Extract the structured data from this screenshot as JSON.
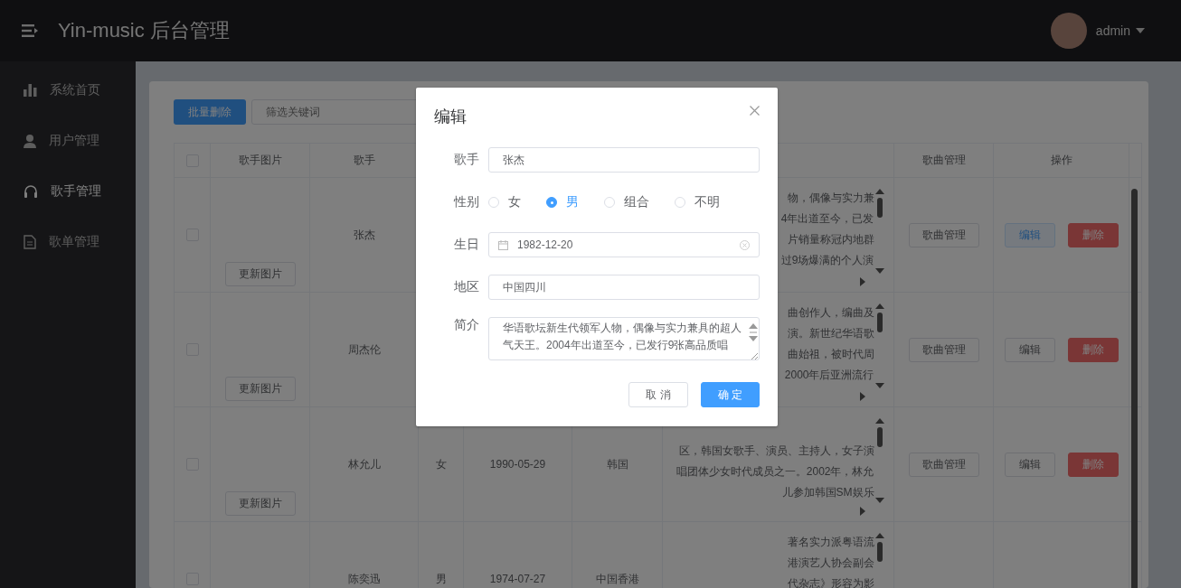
{
  "header": {
    "title": "Yin-music 后台管理",
    "user": "admin"
  },
  "sidebar": {
    "items": [
      {
        "kind": "chart",
        "label": "系统首页",
        "selected": false
      },
      {
        "kind": "user",
        "label": "用户管理",
        "selected": false
      },
      {
        "kind": "headset",
        "label": "歌手管理",
        "selected": true
      },
      {
        "kind": "doc",
        "label": "歌单管理",
        "selected": false
      }
    ]
  },
  "toolbar": {
    "batch_delete": "批量删除",
    "search": {
      "placeholder": "筛选关键词"
    }
  },
  "table": {
    "select_all": {
      "checked": false
    },
    "columns": [
      {
        "kind": "button",
        "label": "歌手图片"
      },
      {
        "kind": "text",
        "label": "歌手"
      },
      {
        "kind": "text"
      },
      {
        "kind": "text"
      },
      {
        "kind": "text"
      },
      {
        "kind": "intro"
      },
      {
        "kind": "button",
        "label": "歌曲管理"
      },
      {
        "kind": "actions",
        "label": "操作"
      }
    ],
    "rows": [
      {
        "checked": false,
        "cells": [
          "更新图片",
          "张杰",
          null,
          null,
          null,
          [
            "物，偶像与实力兼",
            "4年出道至今，已发",
            "片销量称冠内地群",
            "过9场爆满的个人演"
          ],
          "歌曲管理",
          [
            {
              "kind": "edit",
              "label": "编辑",
              "focused": true
            },
            {
              "kind": "delete",
              "label": "删除",
              "focused": false
            }
          ]
        ]
      },
      {
        "checked": false,
        "cells": [
          "更新图片",
          "周杰伦",
          null,
          null,
          null,
          [
            "曲创作人，编曲及",
            "演。新世纪华语歌",
            "曲始祖，被时代周",
            "2000年后亚洲流行"
          ],
          "歌曲管理",
          [
            {
              "kind": "edit",
              "label": "编辑",
              "focused": false
            },
            {
              "kind": "delete",
              "label": "删除",
              "focused": false
            }
          ]
        ]
      },
      {
        "checked": false,
        "cells": [
          "更新图片",
          "林允儿",
          "女",
          "1990-05-29",
          "韩国",
          [
            "区，韩国女歌手、演员、主持人，女子演",
            "唱团体少女时代成员之一。2002年，林允",
            "儿参加韩国SM娱乐"
          ],
          "歌曲管理",
          [
            {
              "kind": "edit",
              "label": "编辑",
              "focused": false
            },
            {
              "kind": "delete",
              "label": "删除",
              "focused": false
            }
          ]
        ]
      },
      {
        "checked": false,
        "cells": [
          null,
          "陈奕迅",
          "男",
          "1974-07-27",
          "中国香港",
          [
            "著名实力派粤语流",
            "港演艺人协会副会",
            "代杂志》形容为影"
          ],
          null,
          null
        ]
      }
    ]
  },
  "dialog": {
    "title": "编辑",
    "fields": [
      {
        "kind": "text",
        "label": "歌手",
        "value": "张杰"
      },
      {
        "kind": "radio",
        "label": "性别",
        "options": [
          {
            "label": "女",
            "selected": false
          },
          {
            "label": "男",
            "selected": true
          },
          {
            "label": "组合",
            "selected": false
          },
          {
            "label": "不明",
            "selected": false
          }
        ]
      },
      {
        "kind": "date",
        "label": "生日",
        "value": "1982-12-20"
      },
      {
        "kind": "text",
        "label": "地区",
        "value": "中国四川"
      },
      {
        "kind": "textarea",
        "label": "简介",
        "value": "华语歌坛新生代领军人物，偶像与实力兼具的超人气天王。2004年出道至今，已发行9张高品质唱"
      }
    ],
    "buttons": [
      {
        "kind": "cancel",
        "label": "取 消"
      },
      {
        "kind": "confirm",
        "label": "确 定"
      }
    ]
  }
}
